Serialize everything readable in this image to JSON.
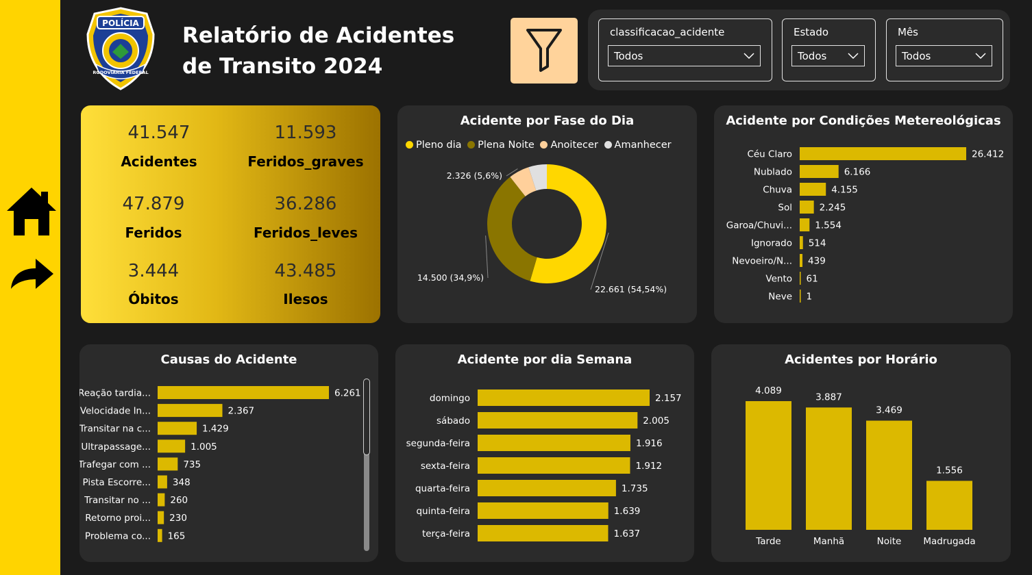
{
  "header": {
    "title_line1": "Relatório de Acidentes",
    "title_line2": "de Transito 2024",
    "logo_text_top": "POLÍCIA",
    "logo_text_bottom": "RODOVIÁRIA FEDERAL"
  },
  "colors": {
    "accent": "#ffd400",
    "bar": "#dcb900",
    "panel": "#2b2b2b",
    "background": "#1b1b1b",
    "filter_button": "#ffd39b"
  },
  "nav": {
    "home_icon": "home-icon",
    "forward_icon": "share-arrow-icon"
  },
  "filter_button": {
    "icon": "funnel-icon"
  },
  "slicers": [
    {
      "label": "classificacao_acidente",
      "value": "Todos"
    },
    {
      "label": "Estado",
      "value": "Todos"
    },
    {
      "label": "Mês",
      "value": "Todos"
    }
  ],
  "kpis": [
    {
      "value": "41.547",
      "label": "Acidentes"
    },
    {
      "value": "11.593",
      "label": "Feridos_graves"
    },
    {
      "value": "47.879",
      "label": "Feridos"
    },
    {
      "value": "36.286",
      "label": "Feridos_leves"
    },
    {
      "value": "3.444",
      "label": "Óbitos"
    },
    {
      "value": "43.485",
      "label": "Ilesos"
    }
  ],
  "chart_data": [
    {
      "type": "pie",
      "variant": "donut",
      "title": "Acidente por Fase do Dia",
      "legend_position": "top-left",
      "categories": [
        "Pleno dia",
        "Plena Noite",
        "Anoitecer",
        "Amanhecer"
      ],
      "values": [
        22661,
        14500,
        2326,
        2060
      ],
      "colors": [
        "#ffd700",
        "#8a7500",
        "#ffd09b",
        "#e0e0e0"
      ],
      "data_labels": [
        "22.661 (54,54%)",
        "14.500 (34,9%)",
        "2.326 (5,6%)",
        null
      ]
    },
    {
      "type": "bar",
      "orientation": "horizontal",
      "title": "Acidente por Condições Metereológicas",
      "categories": [
        "Céu Claro",
        "Nublado",
        "Chuva",
        "Sol",
        "Garoa/Chuvi...",
        "Ignorado",
        "Nevoeiro/N...",
        "Vento",
        "Neve"
      ],
      "values": [
        26412,
        6166,
        4155,
        2245,
        1554,
        514,
        439,
        61,
        1
      ],
      "value_labels": [
        "26.412",
        "6.166",
        "4.155",
        "2.245",
        "1.554",
        "514",
        "439",
        "61",
        "1"
      ]
    },
    {
      "type": "bar",
      "orientation": "horizontal",
      "title": "Causas do Acidente",
      "scrollable": true,
      "categories": [
        "Reação tardia...",
        "Velocidade In...",
        "Transitar na c...",
        "Ultrapassage...",
        "Trafegar com ...",
        "Pista Escorre...",
        "Transitar no ...",
        "Retorno proi...",
        "Problema co..."
      ],
      "values": [
        6261,
        2367,
        1429,
        1005,
        735,
        348,
        260,
        230,
        165
      ],
      "value_labels": [
        "6.261",
        "2.367",
        "1.429",
        "1.005",
        "735",
        "348",
        "260",
        "230",
        "165"
      ]
    },
    {
      "type": "bar",
      "orientation": "horizontal",
      "title": "Acidente por dia Semana",
      "categories": [
        "domingo",
        "sábado",
        "segunda-feira",
        "sexta-feira",
        "quarta-feira",
        "quinta-feira",
        "terça-feira"
      ],
      "values": [
        2157,
        2005,
        1916,
        1912,
        1735,
        1639,
        1637
      ],
      "value_labels": [
        "2.157",
        "2.005",
        "1.916",
        "1.912",
        "1.735",
        "1.639",
        "1.637"
      ]
    },
    {
      "type": "bar",
      "orientation": "vertical",
      "title": "Acidentes por Horário",
      "categories": [
        "Tarde",
        "Manhã",
        "Noite",
        "Madrugada"
      ],
      "values": [
        4089,
        3887,
        3469,
        1556
      ],
      "value_labels": [
        "4.089",
        "3.887",
        "3.469",
        "1.556"
      ]
    }
  ]
}
